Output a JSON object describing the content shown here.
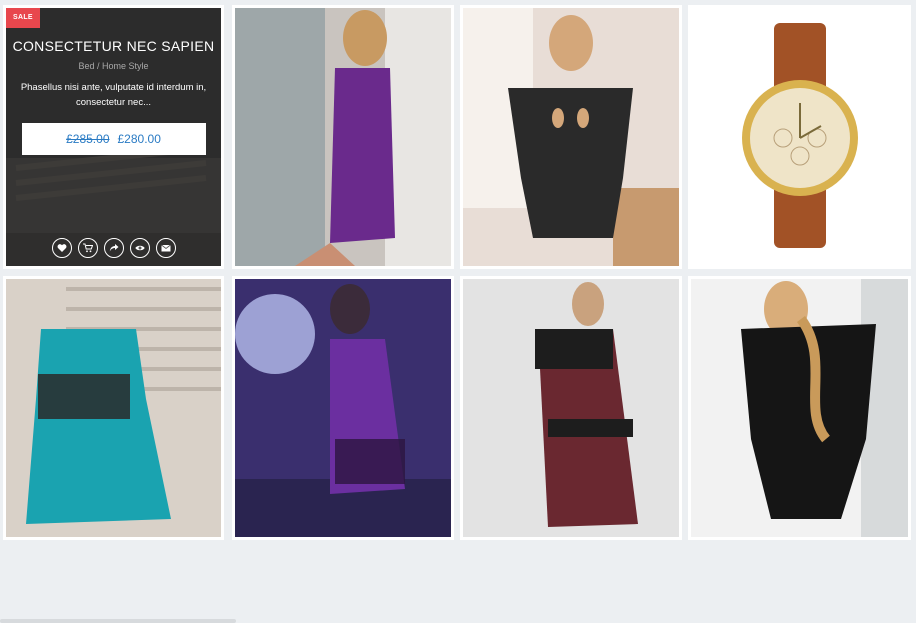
{
  "featured": {
    "badge": "SALE",
    "title": "CONSECTETUR NEC SAPIEN",
    "category": "Bed / Home Style",
    "description": "Phasellus nisi ante, vulputate id interdum in, consectetur nec...",
    "old_price": "£285.00",
    "new_price": "£280.00",
    "actions": [
      "heart-icon",
      "cart-icon",
      "share-icon",
      "eye-icon",
      "mail-icon"
    ]
  },
  "products": [
    {
      "name": "purple satin slip",
      "colors": [
        "#b9b2ad",
        "#6a2a8c"
      ]
    },
    {
      "name": "black cutout bodysuit",
      "colors": [
        "#e8ddd6",
        "#2a2a2a"
      ]
    },
    {
      "name": "gold chronograph watch",
      "colors": [
        "#ffffff",
        "#a25226"
      ]
    },
    {
      "name": "teal satin chemise",
      "colors": [
        "#d9d1c8",
        "#1aa3b0"
      ]
    },
    {
      "name": "violet lace slip",
      "colors": [
        "#3a2f6e",
        "#6b2fa0"
      ]
    },
    {
      "name": "burgundy satin dress",
      "colors": [
        "#e3e3e3",
        "#6a2830"
      ]
    },
    {
      "name": "black lace bodysuit",
      "colors": [
        "#f2f2f2",
        "#151515"
      ]
    }
  ]
}
